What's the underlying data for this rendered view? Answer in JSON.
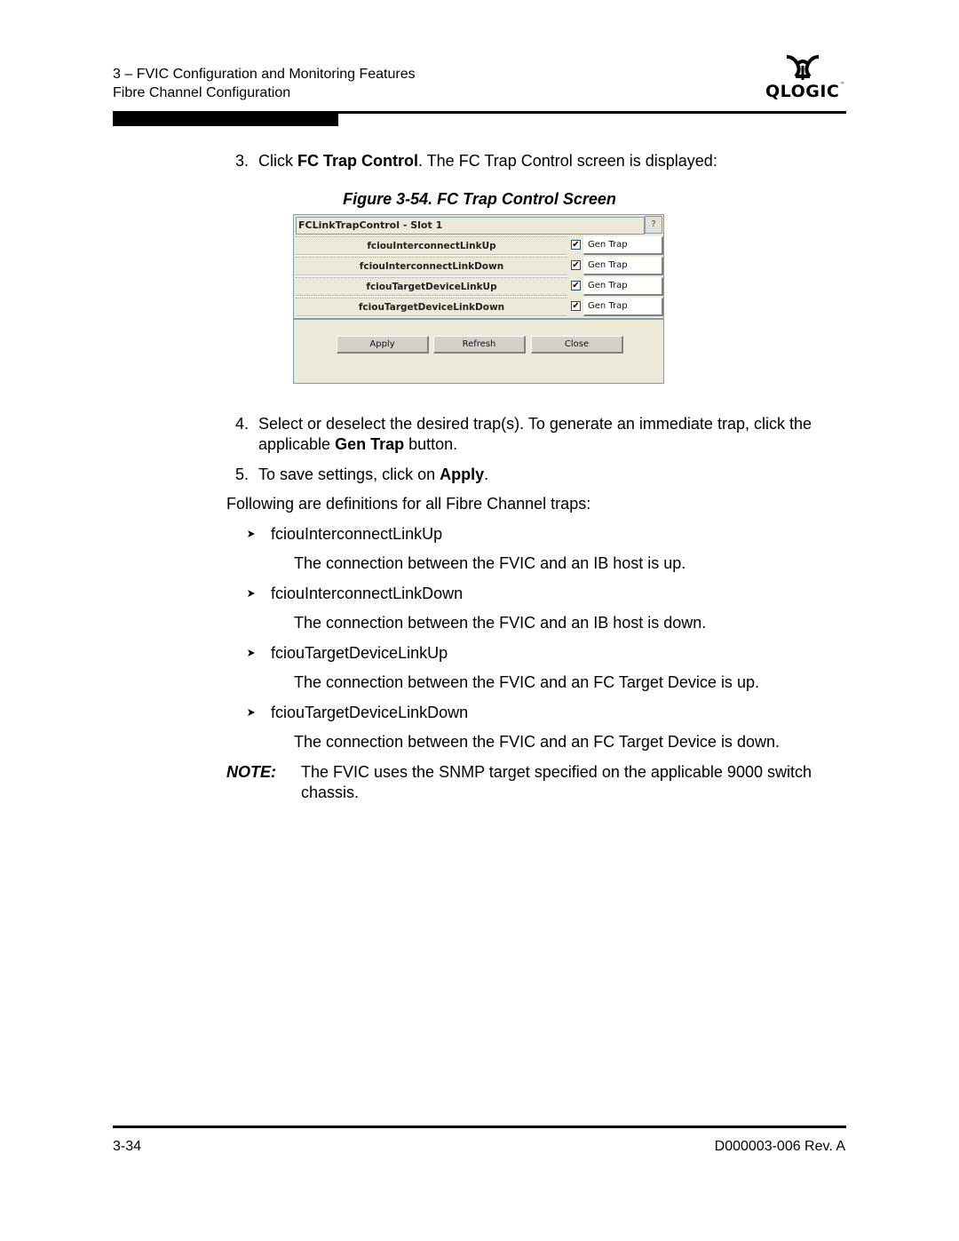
{
  "header": {
    "chapter": "3 – FVIC Configuration and Monitoring Features",
    "section": "Fibre Channel Configuration",
    "logo_text": "QLOGIC",
    "logo_tm": "™"
  },
  "step3": {
    "num": "3.",
    "pre": "Click ",
    "bold": "FC Trap Control",
    "post": ". The FC Trap Control screen is displayed:"
  },
  "figure": {
    "caption": "Figure 3-54. FC Trap Control Screen"
  },
  "dialog": {
    "title": "FCLinkTrapControl - Slot 1",
    "help_label": "?",
    "traps": [
      {
        "name": "fciouInterconnectLinkUp",
        "checked": true,
        "button": "Gen Trap"
      },
      {
        "name": "fciouInterconnectLinkDown",
        "checked": true,
        "button": "Gen Trap"
      },
      {
        "name": "fciouTargetDeviceLinkUp",
        "checked": true,
        "button": "Gen Trap"
      },
      {
        "name": "fciouTargetDeviceLinkDown",
        "checked": true,
        "button": "Gen Trap"
      }
    ],
    "check_glyph": "✔",
    "buttons": {
      "apply": "Apply",
      "refresh": "Refresh",
      "close": "Close"
    }
  },
  "step4": {
    "num": "4.",
    "line1": "Select or deselect the desired trap(s). To generate an immediate trap, click the",
    "line2_pre": "applicable ",
    "line2_bold": "Gen Trap",
    "line2_post": " button."
  },
  "step5": {
    "num": "5.",
    "pre": "To save settings, click on ",
    "bold": "Apply",
    "post": "."
  },
  "intro": "Following are definitions for all Fibre Channel traps:",
  "definitions": [
    {
      "term": "fciouInterconnectLinkUp",
      "desc": "The connection between the FVIC and an IB host is up."
    },
    {
      "term": "fciouInterconnectLinkDown",
      "desc": "The connection between the FVIC and an IB host is down."
    },
    {
      "term": "fciouTargetDeviceLinkUp",
      "desc": "The connection between the FVIC and an FC Target Device is up."
    },
    {
      "term": "fciouTargetDeviceLinkDown",
      "desc": "The connection between the FVIC and an FC Target Device is down."
    }
  ],
  "note": {
    "label": "NOTE:",
    "line1": "The FVIC uses the SNMP target specified on the applicable 9000 switch",
    "line2": "chassis."
  },
  "footer": {
    "page": "3-34",
    "doc": "D000003-006 Rev. A"
  }
}
